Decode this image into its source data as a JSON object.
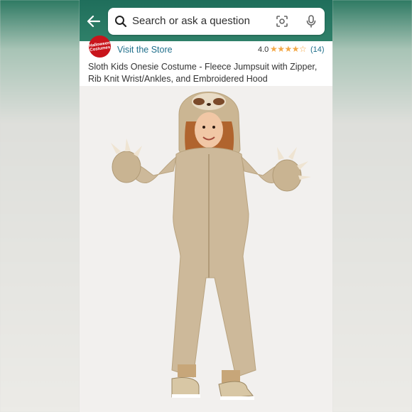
{
  "search": {
    "placeholder": "Search or ask a question",
    "back_icon": "arrow-left-icon",
    "search_icon": "search-icon",
    "lens_icon": "camera-lens-icon",
    "mic_icon": "microphone-icon"
  },
  "store": {
    "logo_text": "Halloween Costumes",
    "visit_label": "Visit the Store",
    "rating": "4.0",
    "stars": "★★★★☆",
    "review_count": "(14)"
  },
  "product": {
    "title": "Sloth Kids Onesie Costume - Fleece Jumpsuit with Zipper, Rib Knit Wrist/Ankles, and Embroidered Hood"
  },
  "colors": {
    "header": "#2f8069",
    "link": "#1f6f8b",
    "star": "#f3a847",
    "costume": "#cdb99a",
    "brand": "#c8141b"
  }
}
